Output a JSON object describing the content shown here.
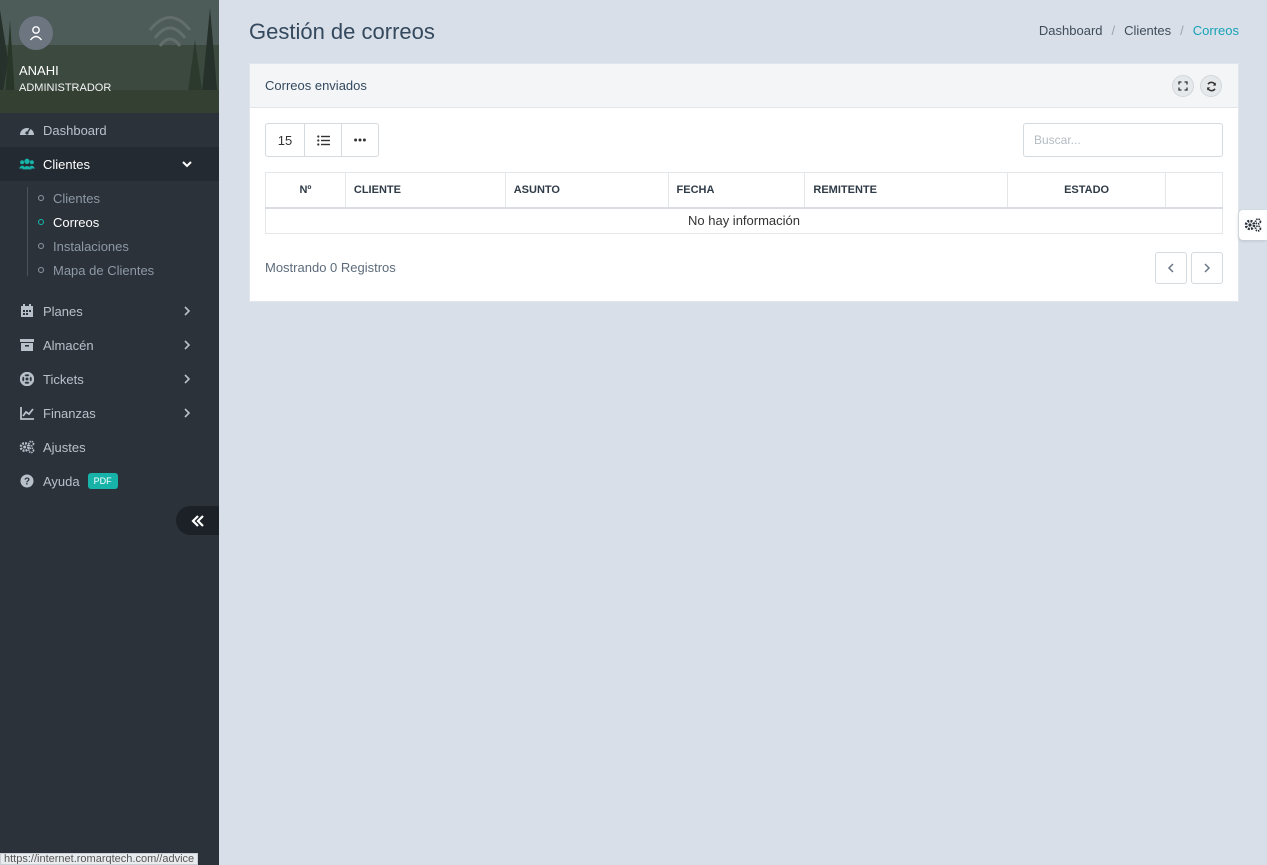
{
  "profile": {
    "name": "ANAHI",
    "role": "ADMINISTRADOR"
  },
  "sidebar": {
    "items": [
      {
        "label": "Dashboard"
      },
      {
        "label": "Clientes",
        "expanded": true,
        "active": true
      },
      {
        "label": "Planes"
      },
      {
        "label": "Almacén"
      },
      {
        "label": "Tickets"
      },
      {
        "label": "Finanzas"
      },
      {
        "label": "Ajustes"
      },
      {
        "label": "Ayuda",
        "badge": "PDF"
      }
    ],
    "submenu": [
      {
        "label": "Clientes"
      },
      {
        "label": "Correos",
        "current": true
      },
      {
        "label": "Instalaciones"
      },
      {
        "label": "Mapa de Clientes"
      }
    ]
  },
  "header": {
    "title": "Gestión de correos",
    "breadcrumb": [
      "Dashboard",
      "Clientes",
      "Correos"
    ]
  },
  "panel": {
    "title": "Correos enviados",
    "page_size": "15",
    "search_placeholder": "Buscar...",
    "columns": [
      "Nº",
      "CLIENTE",
      "ASUNTO",
      "FECHA",
      "REMITENTE",
      "ESTADO",
      ""
    ],
    "empty_message": "No hay información",
    "records_text": "Mostrando 0 Registros"
  },
  "statusbar": {
    "url": "https://internet.romarqtech.com//advice"
  },
  "colors": {
    "accent": "#17b3a9",
    "sidebar_bg": "#2b323a",
    "page_bg": "#d8dfe8"
  }
}
